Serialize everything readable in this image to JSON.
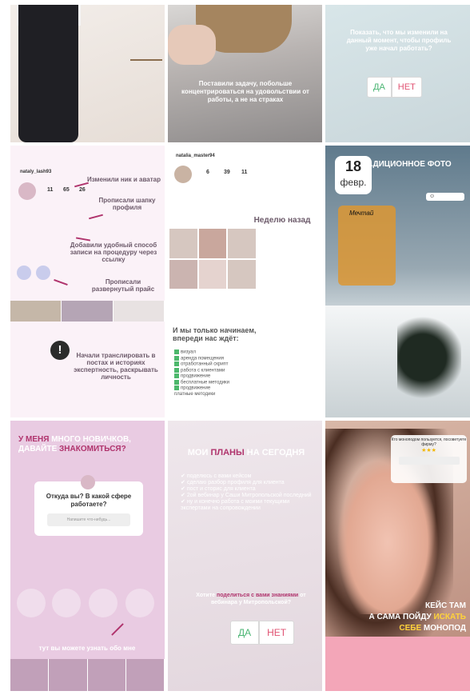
{
  "tile2": {
    "question": "Показать, что мы изменили на данный момент, чтобы профиль уже начал работать?",
    "yes": "ДА",
    "no": "НЕТ"
  },
  "tile1": {
    "caption": "Поставили задачу, побольше концентрироваться на удовольствии от работы, а не на страках"
  },
  "tile3": {
    "username": "nataly_lash93",
    "stat1": "11",
    "stat2": "65",
    "stat3": "26",
    "ann1": "Изменили ник и аватар",
    "ann2": "Прописали шапку профиля",
    "ann3": "Добавили удобный способ записи на процедуру через ссылку",
    "ann4": "Прописали развернутый прайс",
    "ann5": "Начали транслировать в постах и историях экспертность, раскрывать личность",
    "exclaim": "!"
  },
  "tile4": {
    "username": "natalia_master94",
    "stat1": "6",
    "stat2": "39",
    "stat3": "11",
    "week_ago": "Неделю назад",
    "headline": "И мы только начинаем, впереди нас ждёт:",
    "list": [
      "визуал",
      "аренда помещения",
      "отработанный скрипт",
      "работа с клиентами",
      "продвижение",
      "бесплатные методики",
      "продвижение",
      "платные методики"
    ]
  },
  "tile5": {
    "title": "ТРАДИЦИОННОЕ ФОТО",
    "day": "18",
    "month": "февр.",
    "mug_label": "Мечтай"
  },
  "tile6": {
    "headline_part1": "У МЕНЯ",
    "headline_part2": " МНОГО НОВИЧКОВ, ДАВАЙТЕ ",
    "headline_part3": "ЗНАКОМИТЬСЯ?",
    "question": "Откуда вы? В какой сфере работаете?",
    "input_placeholder": "Напишите что-нибудь...",
    "footer": "тут вы можете узнать обо мне"
  },
  "tile7": {
    "title_part1": "МОИ ",
    "title_part2": "ПЛАНЫ",
    "title_part3": " НА СЕГОДНЯ",
    "items": [
      "поделюсь с вами кейсом",
      "сделаю разбор профиля для клиента",
      "пост и сторис для клиента",
      "2ой вебинар у Саши Митропольской последний",
      "ну и конечно работа с моими текущими экспертами на сопровождении"
    ],
    "prompt_part1": "Хотите ",
    "prompt_part2": "поделиться с вами знаниями",
    "prompt_part3": " от вебинара у Митропольской?",
    "yes": "ДА",
    "no": "НЕТ"
  },
  "tile8": {
    "question": "Кто моноподом пользуется, посоветуете фирму?",
    "stars": "★★★",
    "caption_part1": "КЕЙС ТАМ",
    "caption_part2": "А САМА ПОЙДУ ",
    "caption_part3": "ИСКАТЬ",
    "caption_part4": "СЕБЕ ",
    "caption_part5": "МОНОПОД"
  }
}
